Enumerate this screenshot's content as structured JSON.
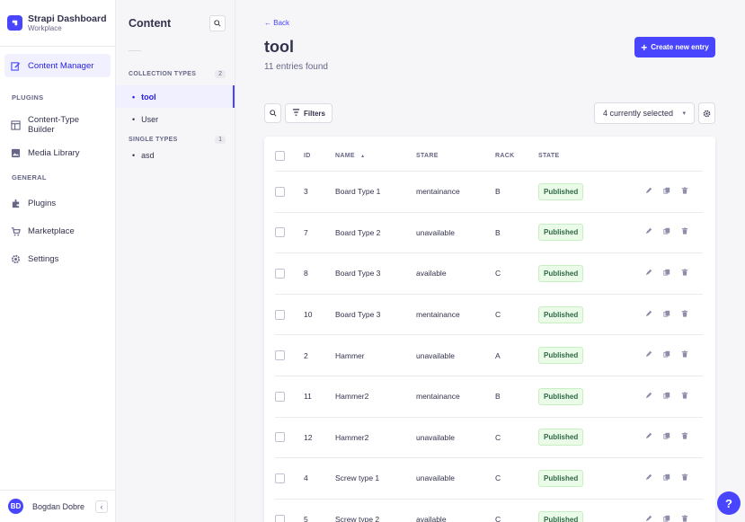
{
  "brand": {
    "title": "Strapi Dashboard",
    "subtitle": "Workplace"
  },
  "mainnav": {
    "content_manager": "Content Manager",
    "plugins_label": "PLUGINS",
    "ctb": "Content-Type Builder",
    "media": "Media Library",
    "general_label": "GENERAL",
    "plugins": "Plugins",
    "marketplace": "Marketplace",
    "settings": "Settings"
  },
  "user": {
    "initials": "BD",
    "name": "Bogdan Dobre",
    "collapse": "‹"
  },
  "subnav": {
    "title": "Content",
    "collection_label": "COLLECTION TYPES",
    "collection_count": "2",
    "collection_items": [
      "tool",
      "User"
    ],
    "single_label": "SINGLE TYPES",
    "single_count": "1",
    "single_items": [
      "asd"
    ]
  },
  "header": {
    "back": "Back",
    "title": "tool",
    "entries": "11 entries found",
    "create": "Create new entry"
  },
  "toolbar": {
    "filters": "Filters",
    "selected": "4 currently selected"
  },
  "table": {
    "columns": [
      "ID",
      "NAME",
      "STARE",
      "RACK",
      "STATE"
    ],
    "sort_indicator": "▲",
    "rows": [
      {
        "id": "3",
        "name": "Board Type 1",
        "stare": "mentainance",
        "rack": "B",
        "state": "Published"
      },
      {
        "id": "7",
        "name": "Board Type 2",
        "stare": "unavailable",
        "rack": "B",
        "state": "Published"
      },
      {
        "id": "8",
        "name": "Board Type 3",
        "stare": "available",
        "rack": "C",
        "state": "Published"
      },
      {
        "id": "10",
        "name": "Board Type 3",
        "stare": "mentainance",
        "rack": "C",
        "state": "Published"
      },
      {
        "id": "2",
        "name": "Hammer",
        "stare": "unavailable",
        "rack": "A",
        "state": "Published"
      },
      {
        "id": "11",
        "name": "Hammer2",
        "stare": "mentainance",
        "rack": "B",
        "state": "Published"
      },
      {
        "id": "12",
        "name": "Hammer2",
        "stare": "unavailable",
        "rack": "C",
        "state": "Published"
      },
      {
        "id": "4",
        "name": "Screw type 1",
        "stare": "unavailable",
        "rack": "C",
        "state": "Published"
      },
      {
        "id": "5",
        "name": "Screw type 2",
        "stare": "available",
        "rack": "C",
        "state": "Published"
      }
    ]
  },
  "help": "?",
  "colors": {
    "primary": "#4945ff",
    "published_bg": "#eafbe7",
    "published_text": "#2f6846"
  }
}
